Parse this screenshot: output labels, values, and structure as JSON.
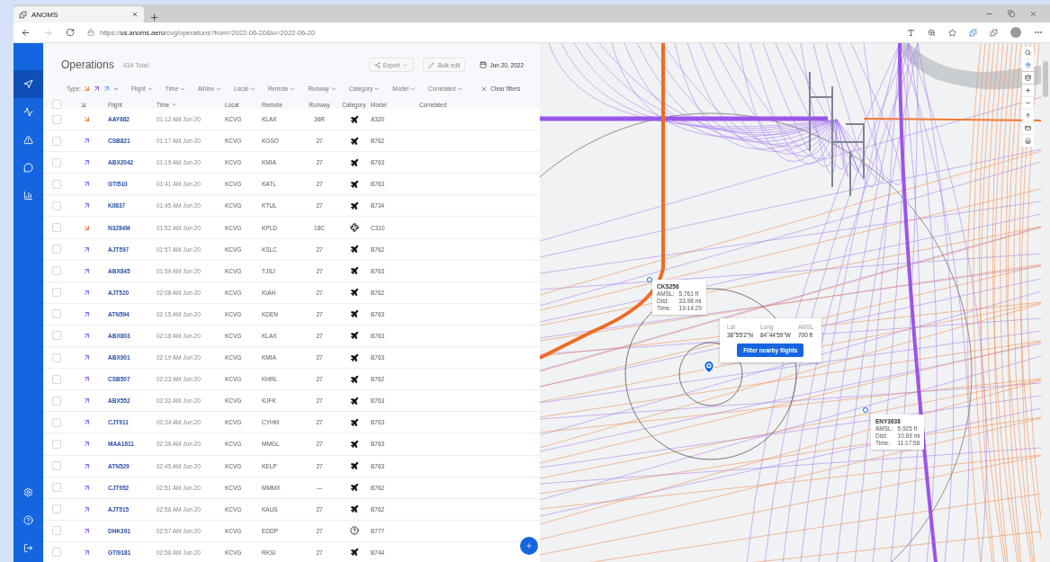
{
  "browser": {
    "tab_title": "ANOMS",
    "url": "https://**us.anoms.aero**/cvg/operations?from=2022-06-20&to=2022-06-20"
  },
  "sidebar": {
    "top_items": [
      {
        "selected": true
      },
      {
        "selected": false
      },
      {
        "selected": false
      },
      {
        "selected": false
      },
      {
        "selected": false
      }
    ]
  },
  "header": {
    "title": "Operations",
    "total": "434 Total",
    "export": "Export",
    "bulk_edit": "Bulk edit",
    "date": "Jun 20, 2022"
  },
  "filters": {
    "type_label": "Type:",
    "types": [
      {
        "kind": "arrival"
      },
      {
        "kind": "departure"
      },
      {
        "kind": "overflight"
      }
    ],
    "items": [
      "Flight",
      "Time",
      "Airline",
      "Local",
      "Remote",
      "Runway",
      "Category",
      "Model",
      "Correlated"
    ],
    "clear": "Clear filters"
  },
  "all_selected": false,
  "columns": [
    "Flight",
    "Time",
    "Local",
    "Remote",
    "Runway",
    "Category",
    "Model",
    "Correlated"
  ],
  "rows": [
    {
      "checked": false,
      "direction": {
        "kind": "arrival"
      },
      "flight": "AAY682",
      "time": "01:12 AM Jun 20",
      "local": "KCVG",
      "remote": "KLAX",
      "runway": "36R",
      "category": {
        "kind": "jet"
      },
      "model": "A320"
    },
    {
      "checked": false,
      "direction": {
        "kind": "departure"
      },
      "flight": "CSB821",
      "time": "01:17 AM Jun 20",
      "local": "KCVG",
      "remote": "KGSO",
      "runway": "27",
      "category": {
        "kind": "jet"
      },
      "model": "B762"
    },
    {
      "checked": false,
      "direction": {
        "kind": "departure"
      },
      "flight": "ABX2042",
      "time": "01:19 AM Jun 20",
      "local": "KCVG",
      "remote": "KMIA",
      "runway": "27",
      "category": {
        "kind": "jet"
      },
      "model": "B763"
    },
    {
      "checked": false,
      "direction": {
        "kind": "departure"
      },
      "flight": "GTI510",
      "time": "01:41 AM Jun 20",
      "local": "KCVG",
      "remote": "KATL",
      "runway": "27",
      "category": {
        "kind": "jet"
      },
      "model": "B763"
    },
    {
      "checked": false,
      "direction": {
        "kind": "departure"
      },
      "flight": "KII837",
      "time": "01:45 AM Jun 20",
      "local": "KCVG",
      "remote": "KTUL",
      "runway": "27",
      "category": {
        "kind": "jet"
      },
      "model": "B734"
    },
    {
      "checked": false,
      "direction": {
        "kind": "arrival"
      },
      "flight": "N3284M",
      "time": "01:52 AM Jun 20",
      "local": "KCVG",
      "remote": "KPLD",
      "runway": "18C",
      "category": {
        "kind": "prop"
      },
      "model": "C310"
    },
    {
      "checked": false,
      "direction": {
        "kind": "departure"
      },
      "flight": "AJT597",
      "time": "01:57 AM Jun 20",
      "local": "KCVG",
      "remote": "KSLC",
      "runway": "27",
      "category": {
        "kind": "jet"
      },
      "model": "B762"
    },
    {
      "checked": false,
      "direction": {
        "kind": "departure"
      },
      "flight": "ABX845",
      "time": "01:59 AM Jun 20",
      "local": "KCVG",
      "remote": "TJSJ",
      "runway": "27",
      "category": {
        "kind": "jet"
      },
      "model": "B763"
    },
    {
      "checked": false,
      "direction": {
        "kind": "departure"
      },
      "flight": "AJT520",
      "time": "02:08 AM Jun 20",
      "local": "KCVG",
      "remote": "KIAH",
      "runway": "27",
      "category": {
        "kind": "jet"
      },
      "model": "B762"
    },
    {
      "checked": false,
      "direction": {
        "kind": "departure"
      },
      "flight": "ATN594",
      "time": "02:15 AM Jun 20",
      "local": "KCVG",
      "remote": "KDEN",
      "runway": "27",
      "category": {
        "kind": "jet"
      },
      "model": "B763"
    },
    {
      "checked": false,
      "direction": {
        "kind": "departure"
      },
      "flight": "ABX803",
      "time": "02:18 AM Jun 20",
      "local": "KCVG",
      "remote": "KLAX",
      "runway": "27",
      "category": {
        "kind": "jet"
      },
      "model": "B763"
    },
    {
      "checked": false,
      "direction": {
        "kind": "departure"
      },
      "flight": "ABX901",
      "time": "02:19 AM Jun 20",
      "local": "KCVG",
      "remote": "KMIA",
      "runway": "27",
      "category": {
        "kind": "jet"
      },
      "model": "B763"
    },
    {
      "checked": false,
      "direction": {
        "kind": "departure"
      },
      "flight": "CSB507",
      "time": "02:23 AM Jun 20",
      "local": "KCVG",
      "remote": "KHRL",
      "runway": "27",
      "category": {
        "kind": "jet"
      },
      "model": "B762"
    },
    {
      "checked": false,
      "direction": {
        "kind": "departure"
      },
      "flight": "ABX552",
      "time": "02:32 AM Jun 20",
      "local": "KCVG",
      "remote": "KJFK",
      "runway": "27",
      "category": {
        "kind": "jet"
      },
      "model": "B763"
    },
    {
      "checked": false,
      "direction": {
        "kind": "departure"
      },
      "flight": "CJT911",
      "time": "02:34 AM Jun 20",
      "local": "KCVG",
      "remote": "CYHM",
      "runway": "27",
      "category": {
        "kind": "jet"
      },
      "model": "B763"
    },
    {
      "checked": false,
      "direction": {
        "kind": "departure"
      },
      "flight": "MAA1611",
      "time": "02:36 AM Jun 20",
      "local": "KCVG",
      "remote": "MMGL",
      "runway": "27",
      "category": {
        "kind": "jet"
      },
      "model": "B763"
    },
    {
      "checked": false,
      "direction": {
        "kind": "departure"
      },
      "flight": "ATN529",
      "time": "02:45 AM Jun 20",
      "local": "KCVG",
      "remote": "KELP",
      "runway": "27",
      "category": {
        "kind": "jet"
      },
      "model": "B763"
    },
    {
      "checked": false,
      "direction": {
        "kind": "departure"
      },
      "flight": "CJT952",
      "time": "02:51 AM Jun 20",
      "local": "KCVG",
      "remote": "MMMX",
      "runway": "—",
      "category": {
        "kind": "jet"
      },
      "model": "B762"
    },
    {
      "checked": false,
      "direction": {
        "kind": "departure"
      },
      "flight": "AJT515",
      "time": "02:56 AM Jun 20",
      "local": "KCVG",
      "remote": "KAUS",
      "runway": "27",
      "category": {
        "kind": "jet"
      },
      "model": "B762"
    },
    {
      "checked": false,
      "direction": {
        "kind": "departure"
      },
      "flight": "DHK391",
      "time": "02:57 AM Jun 20",
      "local": "KCVG",
      "remote": "EDDP",
      "runway": "27",
      "category": {
        "kind": "unknown"
      },
      "model": "B777"
    },
    {
      "checked": false,
      "direction": {
        "kind": "departure"
      },
      "flight": "GTI9181",
      "time": "02:58 AM Jun 20",
      "local": "KCVG",
      "remote": "RKSI",
      "runway": "27",
      "category": {
        "kind": "jet"
      },
      "model": "B744"
    }
  ],
  "map": {
    "tracks": [
      {
        "callsign": "CKS256",
        "lines": [
          {
            "label": "AMSL:",
            "value": "5,761 ft"
          },
          {
            "label": "Dist:",
            "value": "33.98 mi"
          },
          {
            "label": "Time:",
            "value": "19:14:29"
          }
        ]
      },
      {
        "callsign": "ENY3638",
        "lines": [
          {
            "label": "AMSL:",
            "value": "5,925 ft"
          },
          {
            "label": "Dist:",
            "value": "10.69 mi"
          },
          {
            "label": "Time:",
            "value": "11:17:58"
          }
        ]
      }
    ],
    "point": {
      "fields": [
        {
          "label": "Lat",
          "value": "38°55'2\"N"
        },
        {
          "label": "Long",
          "value": "84°44'59\"W"
        },
        {
          "label": "AMSL",
          "value": "700 ft"
        }
      ],
      "button": "Filter nearby flights"
    }
  }
}
